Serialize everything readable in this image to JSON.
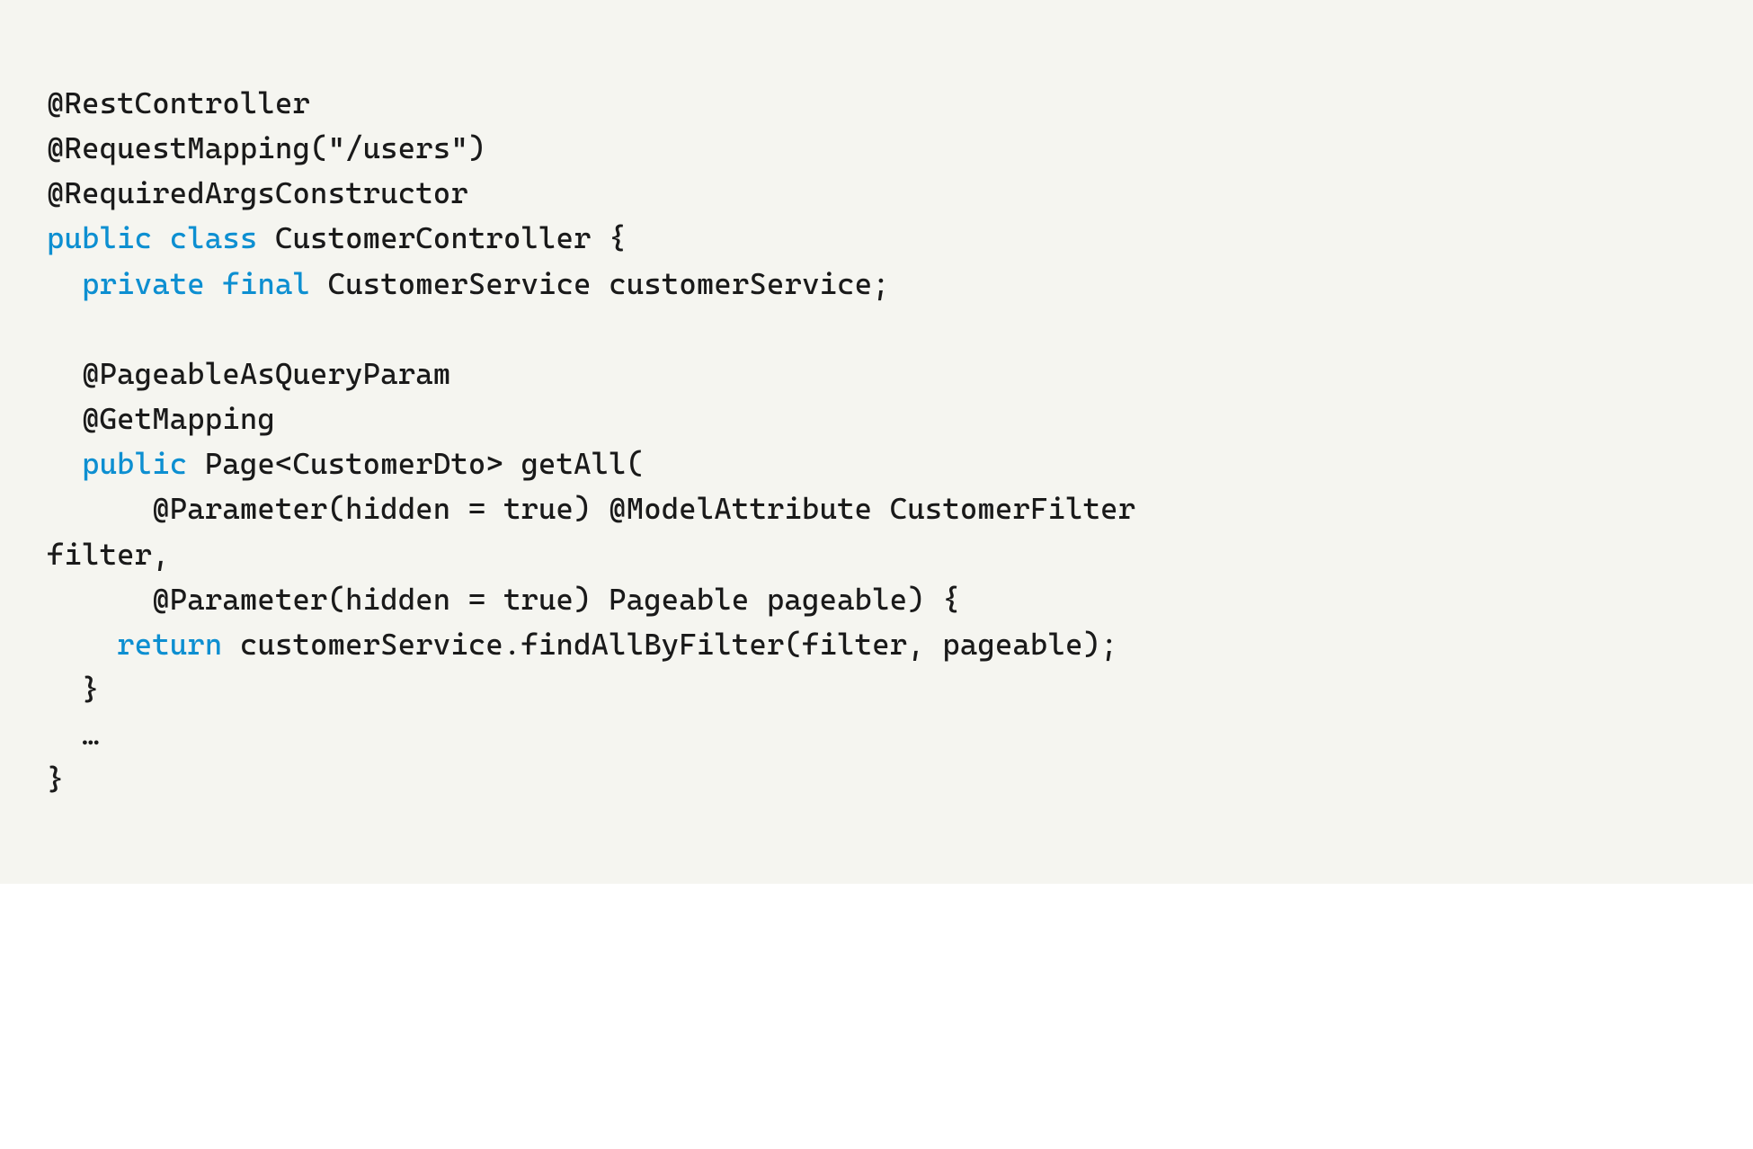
{
  "code": {
    "line1": "@RestController",
    "line2_a": "@RequestMapping(",
    "line2_b": "\"/users\"",
    "line2_c": ")",
    "line3": "@RequiredArgsConstructor",
    "line4_kw1": "public",
    "line4_sp1": " ",
    "line4_kw2": "class",
    "line4_rest": " CustomerController {",
    "line5_indent": "  ",
    "line5_kw1": "private",
    "line5_sp1": " ",
    "line5_kw2": "final",
    "line5_rest": " CustomerService customerService;",
    "line6": "",
    "line7": "  @PageableAsQueryParam",
    "line8": "  @GetMapping",
    "line9_indent": "  ",
    "line9_kw": "public",
    "line9_rest": " Page<CustomerDto> getAll(",
    "line10_a": "      @Parameter(hidden = ",
    "line10_b": "true",
    "line10_c": ") @ModelAttribute CustomerFilter",
    "line11": "filter,",
    "line12_a": "      @Parameter(hidden = ",
    "line12_b": "true",
    "line12_c": ") Pageable pageable) {",
    "line13_indent": "    ",
    "line13_kw": "return",
    "line13_rest": " customerService.findAllByFilter(filter, pageable);",
    "line14": "  }",
    "line15": "  …",
    "line16": "}"
  }
}
